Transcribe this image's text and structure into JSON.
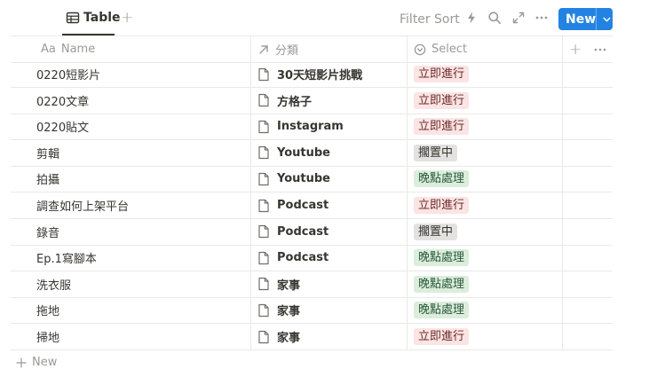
{
  "toolbar": {
    "view_tab_label": "Table",
    "filter_label": "Filter",
    "sort_label": "Sort",
    "new_button_label": "New",
    "icons": [
      "table-icon",
      "add-view-icon",
      "automation-bolt-icon",
      "search-icon",
      "expand-icon",
      "more-icon",
      "chevron-down-icon"
    ]
  },
  "columns": {
    "name": {
      "prefix": "Aa",
      "label": "Name"
    },
    "category": {
      "label": "分類"
    },
    "select": {
      "label": "Select"
    }
  },
  "rows": [
    {
      "name": "0220短影片",
      "category": "30天短影片挑戰",
      "status": "立即進行"
    },
    {
      "name": "0220文章",
      "category": "方格子",
      "status": "立即進行"
    },
    {
      "name": "0220貼文",
      "category": "Instagram",
      "status": "立即進行"
    },
    {
      "name": "剪輯",
      "category": "Youtube",
      "status": "擱置中"
    },
    {
      "name": "拍攝",
      "category": "Youtube",
      "status": "晚點處理"
    },
    {
      "name": "調查如何上架平台",
      "category": "Podcast",
      "status": "立即進行"
    },
    {
      "name": "錄音",
      "category": "Podcast",
      "status": "擱置中"
    },
    {
      "name": "Ep.1寫腳本",
      "category": "Podcast",
      "status": "晚點處理"
    },
    {
      "name": "洗衣服",
      "category": "家事",
      "status": "晚點處理"
    },
    {
      "name": "拖地",
      "category": "家事",
      "status": "晚點處理"
    },
    {
      "name": "掃地",
      "category": "家事",
      "status": "立即進行"
    }
  ],
  "status_styles": {
    "立即進行": {
      "bg": "#fbe4e4",
      "fg": "#6e2b29"
    },
    "擱置中": {
      "bg": "#e3e2e0",
      "fg": "#37352f"
    },
    "晚點處理": {
      "bg": "#dbeddb",
      "fg": "#2b593f"
    }
  },
  "footer": {
    "new_row_label": "New"
  },
  "colors": {
    "accent": "#2383e2",
    "border": "#e9e9e7",
    "muted": "#9b9a97",
    "text": "#37352f"
  }
}
